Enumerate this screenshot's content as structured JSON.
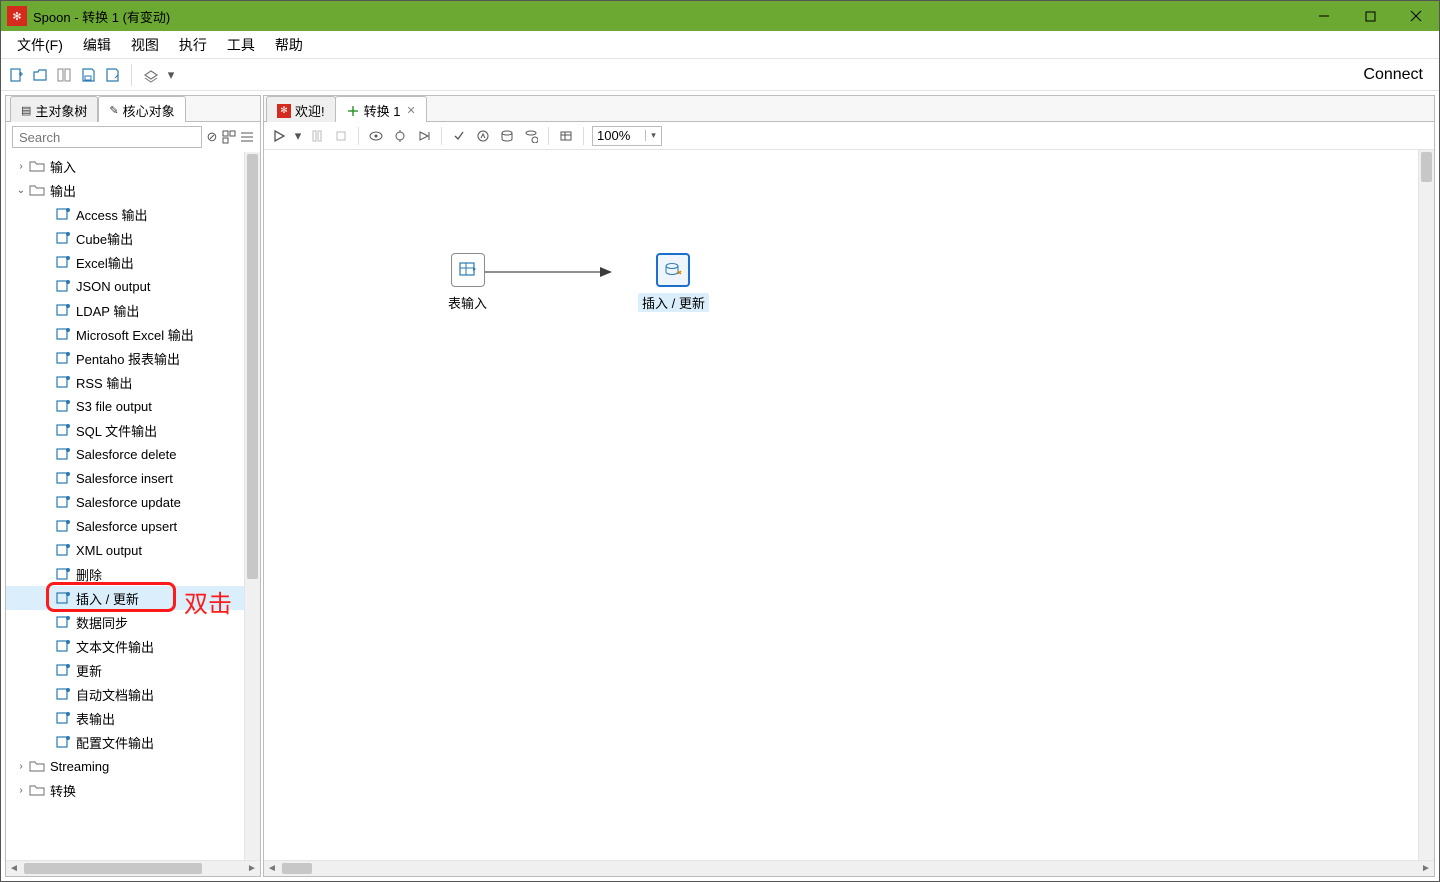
{
  "title": "Spoon - 转换 1 (有变动)",
  "menubar": [
    "文件(F)",
    "编辑",
    "视图",
    "执行",
    "工具",
    "帮助"
  ],
  "toolbar_connect": "Connect",
  "sidebar": {
    "tabs": [
      {
        "label": "主对象树",
        "active": false
      },
      {
        "label": "核心对象",
        "active": true
      }
    ],
    "search_placeholder": "Search",
    "tree": {
      "input_folder": {
        "label": "输入",
        "expanded": false
      },
      "output_folder": {
        "label": "输出",
        "expanded": true
      },
      "output_items": [
        "Access 输出",
        "Cube输出",
        "Excel输出",
        "JSON output",
        "LDAP 输出",
        "Microsoft Excel 输出",
        "Pentaho 报表输出",
        "RSS 输出",
        "S3 file output",
        "SQL 文件输出",
        "Salesforce delete",
        "Salesforce insert",
        "Salesforce update",
        "Salesforce upsert",
        "XML output",
        "删除",
        "插入 / 更新",
        "数据同步",
        "文本文件输出",
        "更新",
        "自动文档输出",
        "表输出",
        "配置文件输出"
      ],
      "selected_output_item": "插入 / 更新",
      "streaming_folder": {
        "label": "Streaming",
        "expanded": false
      },
      "transform_folder": {
        "label": "转换",
        "expanded": false
      }
    }
  },
  "annotation": "双击",
  "editor": {
    "tabs": [
      {
        "label": "欢迎!",
        "active": false,
        "icon": "welcome"
      },
      {
        "label": "转换 1",
        "active": true,
        "icon": "trans"
      }
    ],
    "zoom": "100%",
    "nodes": {
      "table_input": {
        "label": "表输入"
      },
      "insert_update": {
        "label": "插入 / 更新"
      }
    }
  }
}
